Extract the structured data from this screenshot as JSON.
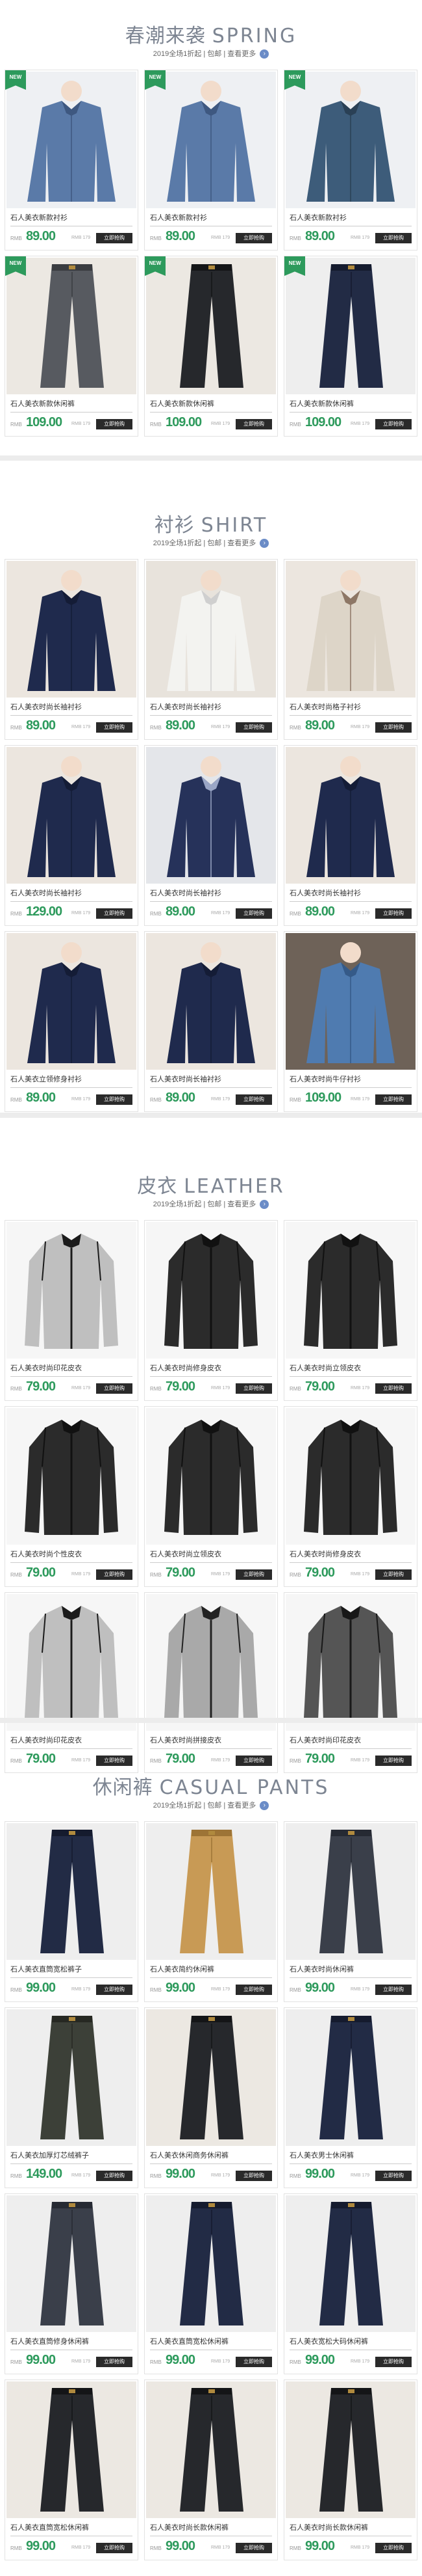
{
  "sections": [
    {
      "title_cn": "春潮来袭",
      "title_en": "SPRING",
      "subtitle": "2019全场1折起 | 包邮 | 查看更多",
      "arrow": "›",
      "products": [
        {
          "name": "石人美衣新款衬衫",
          "price": "89.00",
          "badge": "NEW",
          "image": "denim-shirt"
        },
        {
          "name": "石人美衣新款衬衫",
          "price": "89.00",
          "badge": "NEW",
          "image": "denim-shirt"
        },
        {
          "name": "石人美衣新款衬衫",
          "price": "89.00",
          "badge": "NEW",
          "image": "denim-shirt-dark"
        },
        {
          "name": "石人美衣新款休闲裤",
          "price": "109.00",
          "badge": "NEW",
          "image": "pants-grey"
        },
        {
          "name": "石人美衣新款休闲裤",
          "price": "109.00",
          "badge": "NEW",
          "image": "pants-black"
        },
        {
          "name": "石人美衣新款休闲裤",
          "price": "109.00",
          "badge": "NEW",
          "image": "pants-navy"
        }
      ]
    },
    {
      "title_cn": "衬衫",
      "title_en": "SHIRT",
      "subtitle": "2019全场1折起 | 包邮 | 查看更多",
      "arrow": "›",
      "products": [
        {
          "name": "石人美衣时尚长袖衬衫",
          "price": "89.00",
          "image": "shirt-navy"
        },
        {
          "name": "石人美衣时尚长袖衬衫",
          "price": "89.00",
          "image": "shirt-white"
        },
        {
          "name": "石人美衣时尚格子衬衫",
          "price": "89.00",
          "image": "shirt-check"
        },
        {
          "name": "石人美衣时尚长袖衬衫",
          "price": "129.00",
          "image": "shirt-navy"
        },
        {
          "name": "石人美衣时尚长袖衬衫",
          "price": "89.00",
          "image": "shirt-stripe"
        },
        {
          "name": "石人美衣时尚长袖衬衫",
          "price": "89.00",
          "image": "shirt-navy"
        },
        {
          "name": "石人美衣立领修身衬衫",
          "price": "89.00",
          "image": "shirt-navy"
        },
        {
          "name": "石人美衣时尚长袖衬衫",
          "price": "89.00",
          "image": "shirt-navy"
        },
        {
          "name": "石人美衣时尚牛仔衬衫",
          "price": "109.00",
          "image": "shirt-denim"
        }
      ]
    },
    {
      "title_cn": "皮衣",
      "title_en": "LEATHER",
      "subtitle": "2019全场1折起 | 包邮 | 查看更多",
      "arrow": "›",
      "products": [
        {
          "name": "石人美衣时尚印花皮衣",
          "price": "79.00",
          "image": "jacket-print"
        },
        {
          "name": "石人美衣时尚修身皮衣",
          "price": "79.00",
          "image": "jacket-black"
        },
        {
          "name": "石人美衣时尚立领皮衣",
          "price": "79.00",
          "image": "jacket-black"
        },
        {
          "name": "石人美衣时尚个性皮衣",
          "price": "79.00",
          "image": "jacket-black"
        },
        {
          "name": "石人美衣时尚立领皮衣",
          "price": "79.00",
          "image": "jacket-black"
        },
        {
          "name": "石人美衣时尚修身皮衣",
          "price": "79.00",
          "image": "jacket-black"
        },
        {
          "name": "石人美衣时尚印花皮衣",
          "price": "79.00",
          "image": "jacket-print"
        },
        {
          "name": "石人美衣时尚拼接皮衣",
          "price": "79.00",
          "image": "jacket-grey"
        },
        {
          "name": "石人美衣时尚印花皮衣",
          "price": "79.00",
          "image": "jacket-print-dark"
        }
      ]
    },
    {
      "title_cn": "休闲裤",
      "title_en": "CASUAL PANTS",
      "subtitle": "2019全场1折起 | 包邮 | 查看更多",
      "arrow": "›",
      "products": [
        {
          "name": "石人美衣直筒宽松裤子",
          "price": "99.00",
          "image": "pants-navy"
        },
        {
          "name": "石人美衣简约休闲裤",
          "price": "99.00",
          "image": "pants-khaki"
        },
        {
          "name": "石人美衣时尚休闲裤",
          "price": "99.00",
          "image": "pants-charcoal"
        },
        {
          "name": "石人美衣加厚灯芯绒裤子",
          "price": "149.00",
          "image": "pants-olive"
        },
        {
          "name": "石人美衣休闲商务休闲裤",
          "price": "99.00",
          "image": "pants-black"
        },
        {
          "name": "石人美衣男士休闲裤",
          "price": "99.00",
          "image": "pants-navy"
        },
        {
          "name": "石人美衣直筒修身休闲裤",
          "price": "99.00",
          "image": "pants-charcoal"
        },
        {
          "name": "石人美衣直筒宽松休闲裤",
          "price": "99.00",
          "image": "pants-navy"
        },
        {
          "name": "石人美衣宽松大码休闲裤",
          "price": "99.00",
          "image": "pants-navy"
        },
        {
          "name": "石人美衣直筒宽松休闲裤",
          "price": "99.00",
          "image": "pants-black"
        },
        {
          "name": "石人美衣时尚长款休闲裤",
          "price": "99.00",
          "image": "pants-black"
        },
        {
          "name": "石人美衣时尚长款休闲裤",
          "price": "99.00",
          "image": "pants-black"
        }
      ]
    }
  ],
  "common": {
    "price_label": "RMB",
    "was_label": "RMB 179",
    "button_label": "立即抢购"
  },
  "colors": {
    "accent": "#2d9a5c",
    "title": "#7d8592",
    "button": "#2a2a2a"
  }
}
